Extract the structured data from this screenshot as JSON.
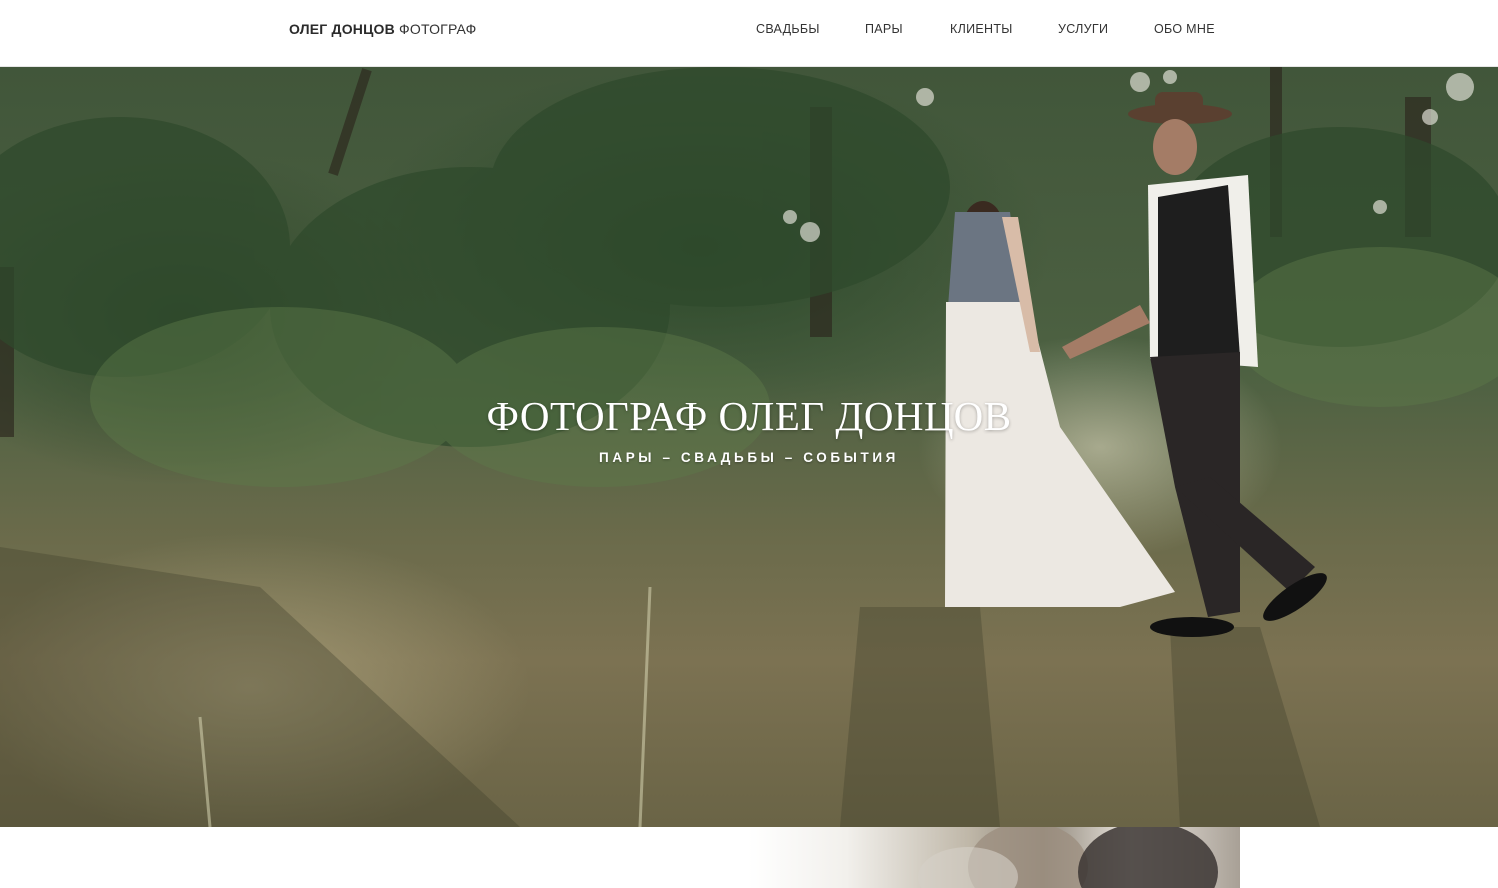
{
  "header": {
    "logo_bold": "ОЛЕГ ДОНЦОВ",
    "logo_light": "ФОТОГРАФ",
    "nav": [
      {
        "label": "СВАДЬБЫ"
      },
      {
        "label": "ПАРЫ"
      },
      {
        "label": "КЛИЕНТЫ"
      },
      {
        "label": "УСЛУГИ"
      },
      {
        "label": "ОБО МНЕ"
      }
    ]
  },
  "hero": {
    "title": "ФОТОГРАФ ОЛЕГ ДОНЦОВ",
    "subtitle": "ПАРЫ – СВАДЬБЫ – СОБЫТИЯ",
    "image": "couple-walking-in-forest-photo"
  },
  "below": {
    "image": "couple-portrait-photo"
  }
}
